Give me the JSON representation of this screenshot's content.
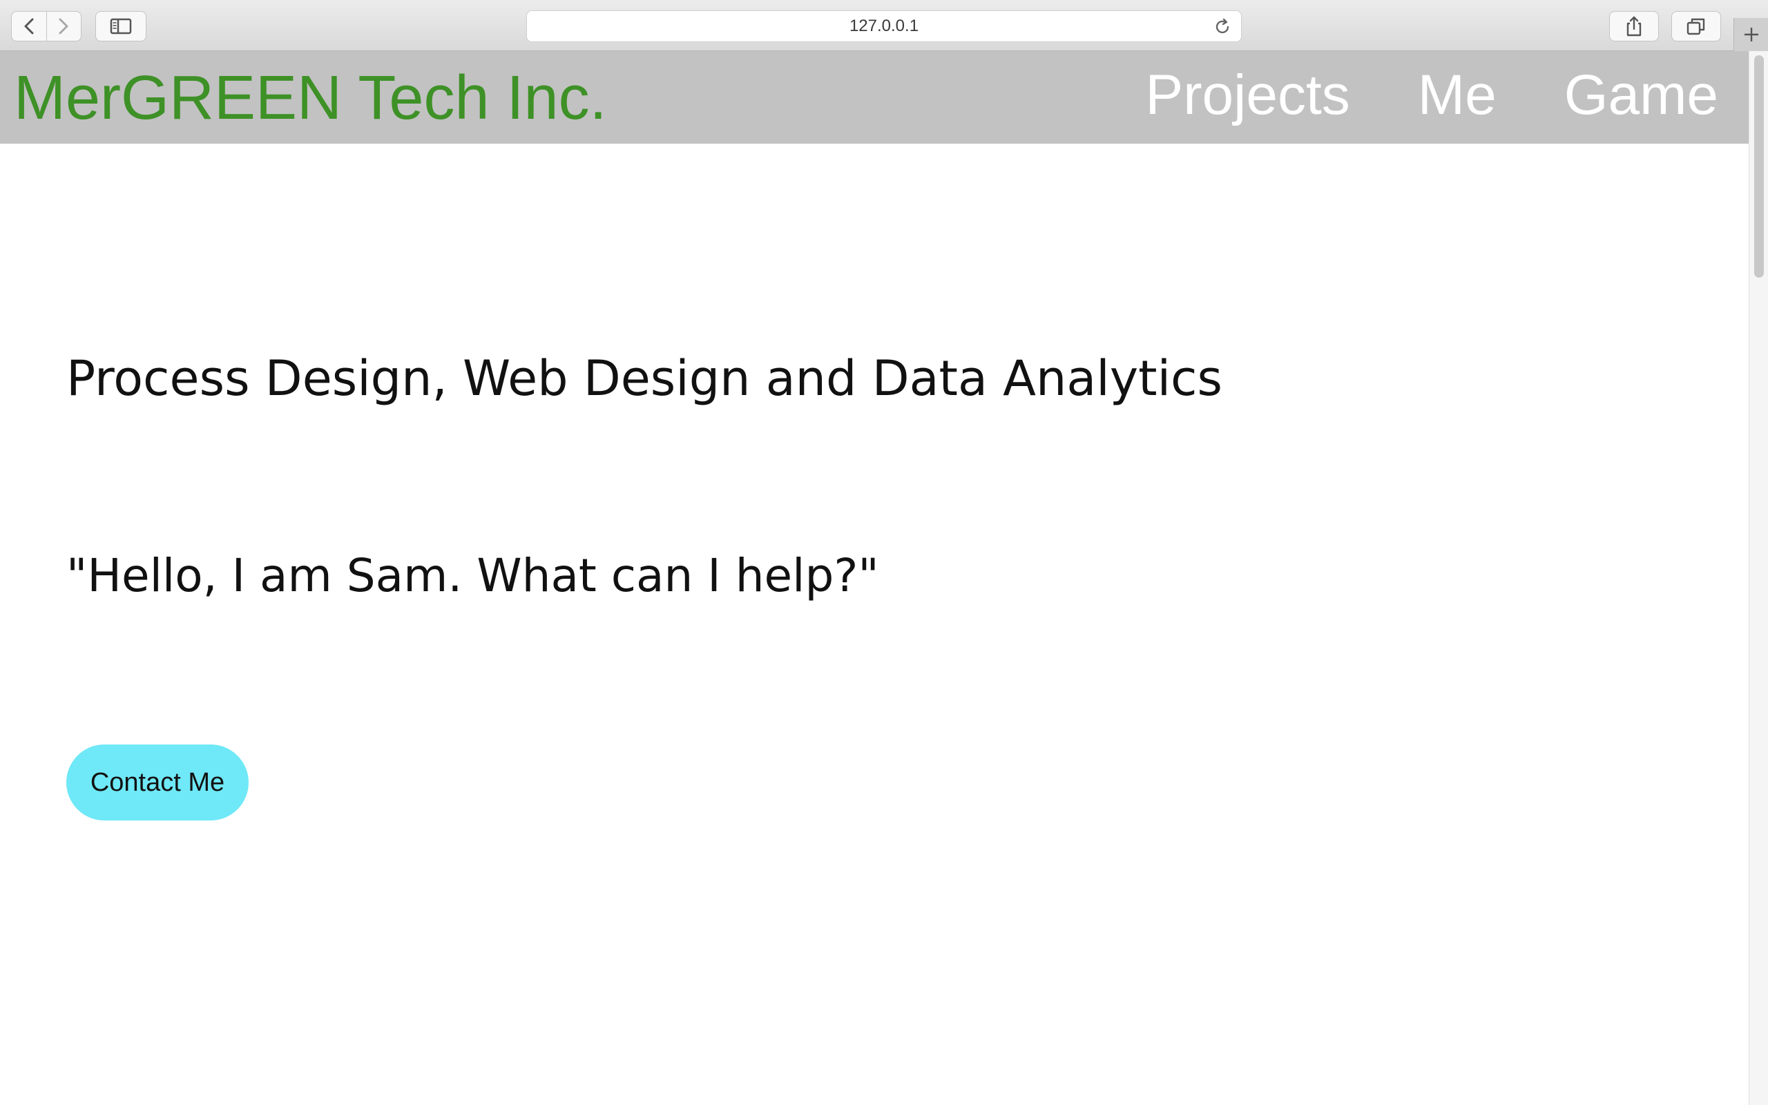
{
  "browser": {
    "url": "127.0.0.1",
    "icons": {
      "back": "chevron-left-icon",
      "forward": "chevron-right-icon",
      "sidebar": "sidebar-icon",
      "reload": "reload-icon",
      "share": "share-icon",
      "tabs": "tabs-overview-icon",
      "new_tab": "plus-icon"
    }
  },
  "site": {
    "brand": "MerGREEN Tech Inc.",
    "nav": [
      "Projects",
      "Me",
      "Game"
    ],
    "headline": "Process Design, Web Design and Data Analytics",
    "quote": "\"Hello, I am Sam. What can I help?\"",
    "cta_label": "Contact Me"
  },
  "colors": {
    "brand": "#3e9126",
    "header_bg": "#c2c2c2",
    "nav_text": "#ffffff",
    "cta_bg": "#6fe8f7"
  }
}
